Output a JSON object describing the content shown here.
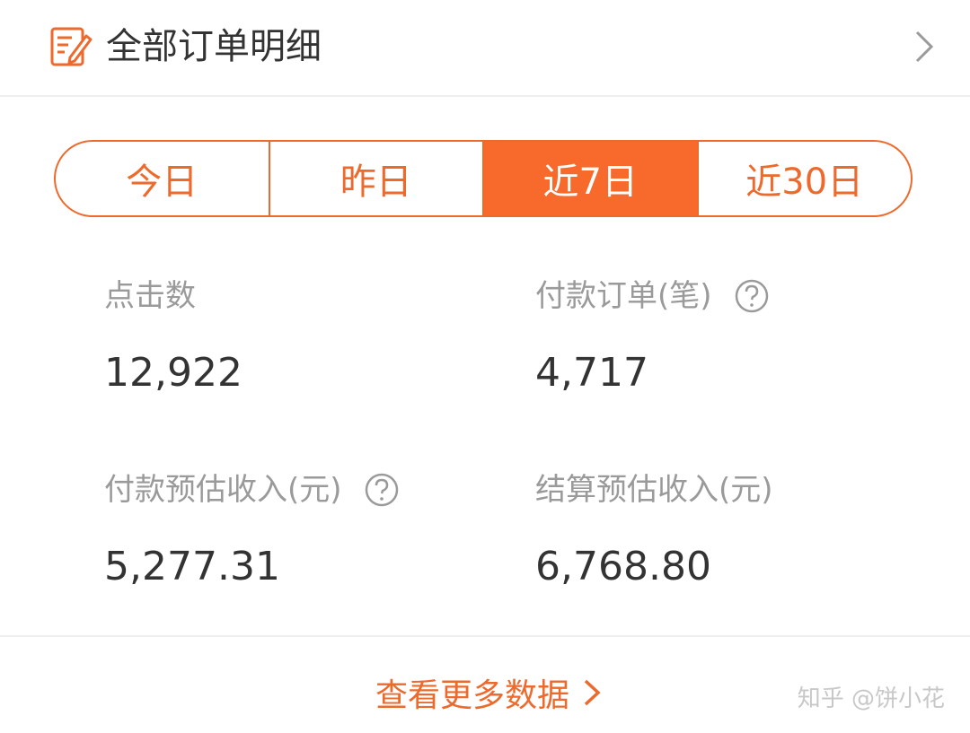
{
  "header": {
    "title": "全部订单明细",
    "icon": "edit-document-icon",
    "chevron_icon": "chevron-right-icon"
  },
  "tabs": [
    {
      "label": "今日",
      "active": false
    },
    {
      "label": "昨日",
      "active": false
    },
    {
      "label": "近7日",
      "active": true
    },
    {
      "label": "近30日",
      "active": false
    }
  ],
  "stats": {
    "clicks": {
      "label": "点击数",
      "value": "12,922"
    },
    "paid_orders": {
      "label": "付款订单(笔)",
      "value": "4,717",
      "help_icon": "question-circle-icon"
    },
    "paid_estimated_income": {
      "label": "付款预估收入(元)",
      "value": "5,277.31",
      "help_icon": "question-circle-icon"
    },
    "settled_estimated_income": {
      "label": "结算预估收入(元)",
      "value": "6,768.80"
    }
  },
  "footer": {
    "more_label": "查看更多数据",
    "watermark": "知乎 @饼小花"
  },
  "colors": {
    "accent": "#f76a2c",
    "text_primary": "#333333",
    "text_secondary": "#9a9a9a",
    "divider": "#eeeeee"
  }
}
